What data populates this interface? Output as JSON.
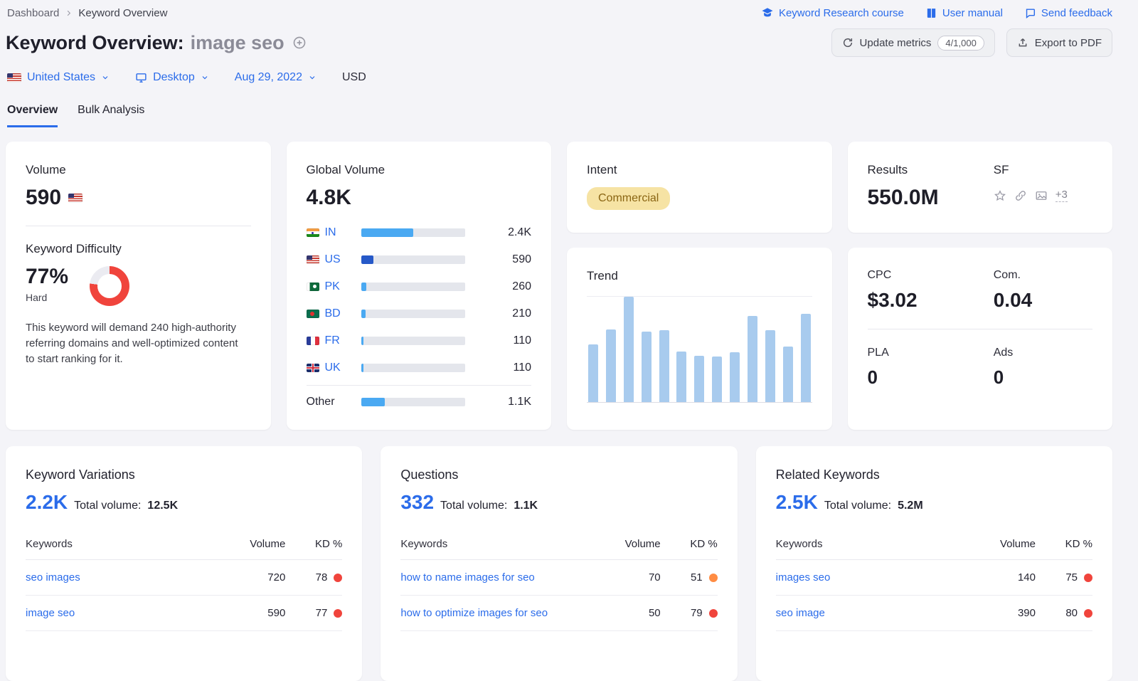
{
  "colors": {
    "accent_blue": "#2b6cea",
    "kd_red": "#f0443c",
    "kd_orange": "#ff8c43",
    "badge_bg": "#f6e3a4",
    "badge_text": "#8a6513",
    "bar_light_blue": "#4aa9f2",
    "bar_dark_blue": "#2659c8",
    "trend_bar_blue": "#a8cbee"
  },
  "breadcrumb": {
    "dashboard": "Dashboard",
    "current": "Keyword Overview"
  },
  "top_links": [
    {
      "label": "Keyword Research course",
      "icon": "graduation-cap-icon"
    },
    {
      "label": "User manual",
      "icon": "book-icon"
    },
    {
      "label": "Send feedback",
      "icon": "feedback-bubble-icon"
    }
  ],
  "header": {
    "title": "Keyword Overview:",
    "keyword": "image seo",
    "update_label": "Update metrics",
    "quota": "4/1,000",
    "export_label": "Export to PDF"
  },
  "filters": {
    "country": "United States",
    "device": "Desktop",
    "date": "Aug 29, 2022",
    "currency": "USD"
  },
  "tabs": [
    {
      "label": "Overview",
      "active": true
    },
    {
      "label": "Bulk Analysis",
      "active": false
    }
  ],
  "volume_card": {
    "title": "Volume",
    "value": "590",
    "kd_title": "Keyword Difficulty",
    "kd_value": "77%",
    "kd_label": "Hard",
    "kd_percent": 77,
    "kd_note": "This keyword will demand 240 high-authority referring domains and well-optimized content to start ranking for it."
  },
  "global_volume": {
    "title": "Global Volume",
    "value": "4.8K",
    "rows": [
      {
        "code": "IN",
        "flag": "in",
        "value": "2.4K",
        "pct": 50,
        "code_link": true,
        "value_link": true,
        "bar_color": "#4aa9f2"
      },
      {
        "code": "US",
        "flag": "us",
        "value": "590",
        "pct": 12.3,
        "code_link": true,
        "value_link": false,
        "bar_color": "#2659c8"
      },
      {
        "code": "PK",
        "flag": "pk",
        "value": "260",
        "pct": 5.4,
        "code_link": true,
        "value_link": true,
        "bar_color": "#4aa9f2"
      },
      {
        "code": "BD",
        "flag": "bd",
        "value": "210",
        "pct": 4.4,
        "code_link": true,
        "value_link": true,
        "bar_color": "#4aa9f2"
      },
      {
        "code": "FR",
        "flag": "fr",
        "value": "110",
        "pct": 2.3,
        "code_link": true,
        "value_link": true,
        "bar_color": "#4aa9f2"
      },
      {
        "code": "UK",
        "flag": "uk",
        "value": "110",
        "pct": 2.3,
        "code_link": true,
        "value_link": true,
        "bar_color": "#4aa9f2"
      },
      {
        "code": "Other",
        "flag": "",
        "value": "1.1K",
        "pct": 22.9,
        "code_link": false,
        "value_link": false,
        "bar_color": "#4aa9f2"
      }
    ]
  },
  "intent_card": {
    "title": "Intent",
    "badge": "Commercial"
  },
  "trend_card": {
    "title": "Trend",
    "values": [
      55,
      69,
      100,
      67,
      68,
      48,
      44,
      43,
      47,
      82,
      68,
      53,
      84
    ]
  },
  "results_card": {
    "title": "Results",
    "value": "550.0M",
    "sf_label": "SF",
    "sf_more": "+3"
  },
  "cpc_card": {
    "cpc_label": "CPC",
    "cpc_value": "$3.02",
    "com_label": "Com.",
    "com_value": "0.04",
    "pla_label": "PLA",
    "pla_value": "0",
    "ads_label": "Ads",
    "ads_value": "0"
  },
  "tables": [
    {
      "title": "Keyword Variations",
      "count": "2.2K",
      "total_label": "Total volume:",
      "total": "12.5K",
      "headers": [
        "Keywords",
        "Volume",
        "KD %"
      ],
      "rows": [
        {
          "keyword": "seo images",
          "volume": "720",
          "kd": "78",
          "dot": "#f0443c"
        },
        {
          "keyword": "image seo",
          "volume": "590",
          "kd": "77",
          "dot": "#f0443c"
        }
      ]
    },
    {
      "title": "Questions",
      "count": "332",
      "total_label": "Total volume:",
      "total": "1.1K",
      "headers": [
        "Keywords",
        "Volume",
        "KD %"
      ],
      "rows": [
        {
          "keyword": "how to name images for seo",
          "volume": "70",
          "kd": "51",
          "dot": "#ff8c43"
        },
        {
          "keyword": "how to optimize images for seo",
          "volume": "50",
          "kd": "79",
          "dot": "#f0443c"
        }
      ]
    },
    {
      "title": "Related Keywords",
      "count": "2.5K",
      "total_label": "Total volume:",
      "total": "5.2M",
      "headers": [
        "Keywords",
        "Volume",
        "KD %"
      ],
      "rows": [
        {
          "keyword": "images seo",
          "volume": "140",
          "kd": "75",
          "dot": "#f0443c"
        },
        {
          "keyword": "seo image",
          "volume": "390",
          "kd": "80",
          "dot": "#f0443c"
        }
      ]
    }
  ]
}
